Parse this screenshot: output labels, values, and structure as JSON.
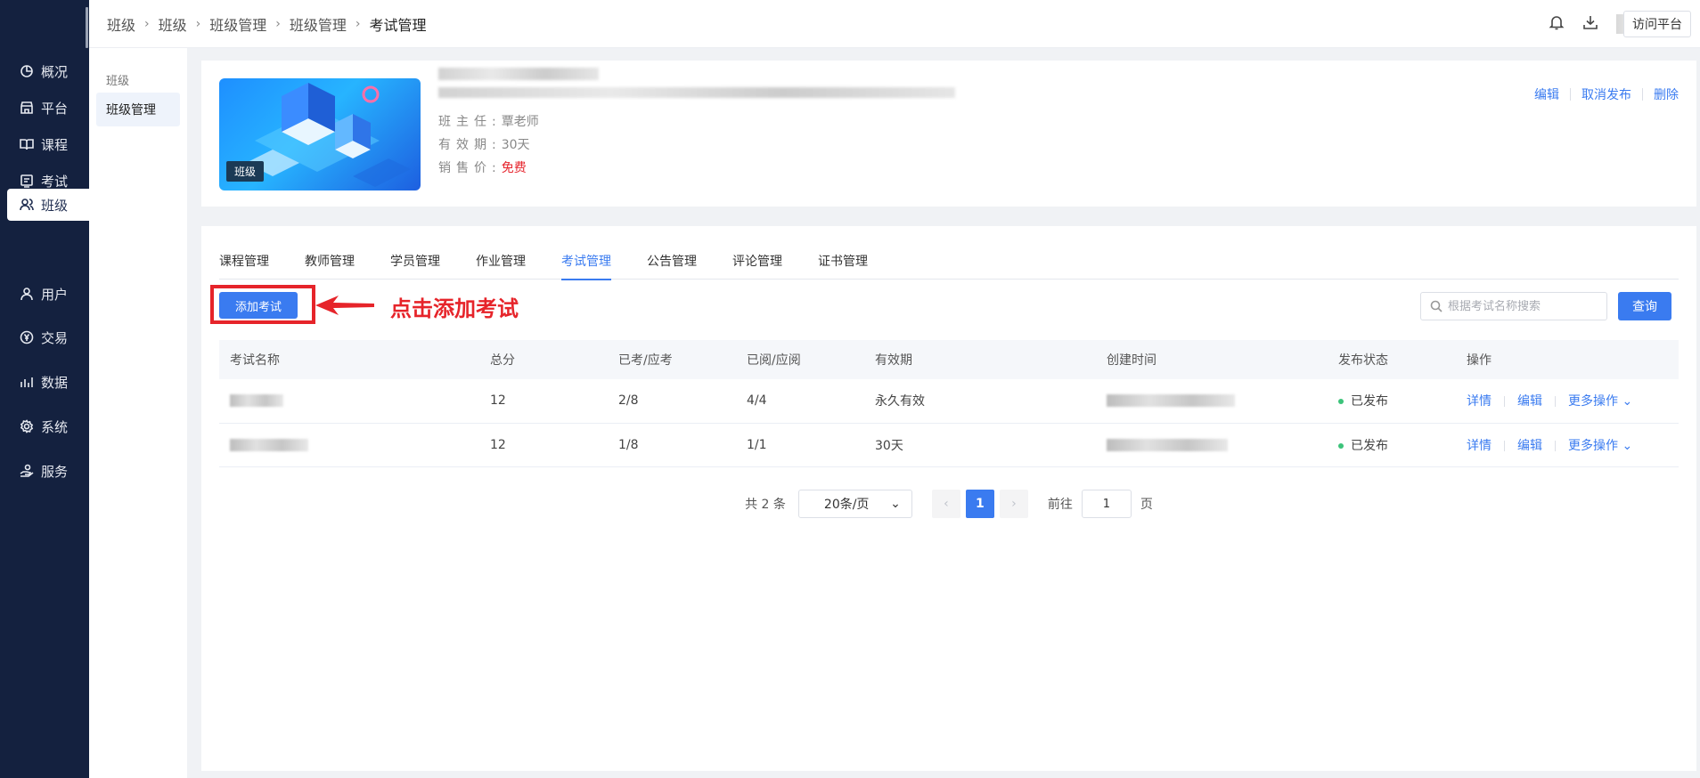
{
  "nav": {
    "items": [
      {
        "label": "概况",
        "icon": "pie-chart-icon"
      },
      {
        "label": "平台",
        "icon": "store-icon"
      },
      {
        "label": "课程",
        "icon": "book-icon"
      },
      {
        "label": "考试",
        "icon": "exam-icon"
      },
      {
        "label": "班级",
        "icon": "class-group-icon"
      },
      {
        "label": "用户",
        "icon": "user-icon"
      },
      {
        "label": "交易",
        "icon": "yen-icon"
      },
      {
        "label": "数据",
        "icon": "bar-chart-icon"
      },
      {
        "label": "系统",
        "icon": "gear-icon"
      },
      {
        "label": "服务",
        "icon": "service-hand-icon"
      }
    ],
    "active_index": 4
  },
  "header": {
    "breadcrumbs": [
      "班级",
      "班级",
      "班级管理",
      "班级管理",
      "考试管理"
    ],
    "visit_label": "访问平台"
  },
  "subnav": {
    "group_label": "班级",
    "item_label": "班级管理"
  },
  "info": {
    "cover_tag": "班级",
    "teacher_key": "班主任:",
    "teacher_value": "覃老师",
    "validity_key": "有效期:",
    "validity_value": "30天",
    "price_key": "销售价:",
    "price_value": "免费",
    "actions": [
      "编辑",
      "取消发布",
      "删除"
    ]
  },
  "tabs": [
    "课程管理",
    "教师管理",
    "学员管理",
    "作业管理",
    "考试管理",
    "公告管理",
    "评论管理",
    "证书管理"
  ],
  "active_tab": 4,
  "toolbar": {
    "add_label": "添加考试",
    "annotation": "点击添加考试",
    "search_placeholder": "根据考试名称搜索",
    "query_label": "查询"
  },
  "table": {
    "headers": [
      "考试名称",
      "总分",
      "已考/应考",
      "已阅/应阅",
      "有效期",
      "创建时间",
      "发布状态",
      "操作"
    ],
    "rows": [
      {
        "score": "12",
        "taken": "2/8",
        "graded": "4/4",
        "validity": "永久有效",
        "status": "已发布"
      },
      {
        "score": "12",
        "taken": "1/8",
        "graded": "1/1",
        "validity": "30天",
        "status": "已发布"
      }
    ],
    "ops": [
      "详情",
      "编辑",
      "更多操作"
    ]
  },
  "pager": {
    "total": "共 2 条",
    "page_size": "20条/页",
    "current": "1",
    "goto_label": "前往",
    "goto_value": "1",
    "page_suffix": "页"
  },
  "colors": {
    "nav_bg": "#14213f",
    "primary": "#3a7bf0",
    "annotation_red": "#e6242a",
    "published_green": "#3cc37a",
    "price_red": "#e6262e"
  }
}
